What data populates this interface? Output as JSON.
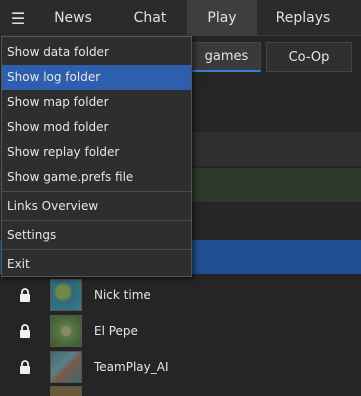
{
  "nav": {
    "menu_icon": "hamburger-icon",
    "tabs": [
      {
        "label": "News",
        "active": false
      },
      {
        "label": "Chat",
        "active": false
      },
      {
        "label": "Play",
        "active": true
      },
      {
        "label": "Replays",
        "active": false
      }
    ]
  },
  "subtabs": [
    {
      "label": "games",
      "active": true
    },
    {
      "label": "Co-Op",
      "active": false
    }
  ],
  "menu": {
    "items": [
      {
        "label": "Show data folder"
      },
      {
        "label": "Show log folder",
        "highlighted": true
      },
      {
        "label": "Show map folder"
      },
      {
        "label": "Show mod folder"
      },
      {
        "label": "Show replay folder"
      },
      {
        "label": "Show game.prefs file"
      },
      {
        "label": "Links Overview"
      },
      {
        "label": "Settings"
      },
      {
        "label": "Exit"
      }
    ]
  },
  "games": [
    {
      "name": "Nick time",
      "locked": true,
      "icon": "lock-icon"
    },
    {
      "name": "El Pepe",
      "locked": true,
      "icon": "lock-icon"
    },
    {
      "name": "TeamPlay_AI",
      "locked": true,
      "icon": "lock-icon"
    }
  ],
  "colors": {
    "accent": "#3c7dd6",
    "highlight": "#2d5fae",
    "selected_row": "#204f92",
    "green_row": "#2b3a2a"
  }
}
